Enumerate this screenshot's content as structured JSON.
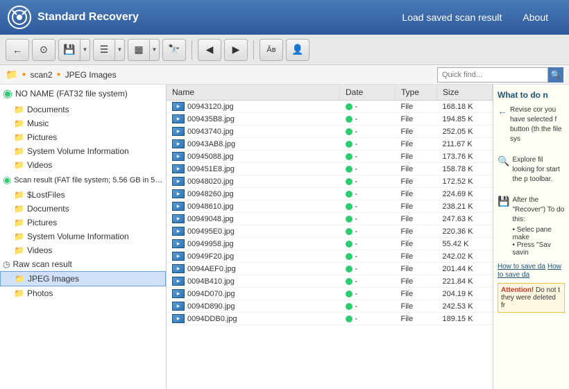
{
  "header": {
    "title": "Standard Recovery",
    "nav": {
      "load_scan": "Load saved scan result",
      "about": "About"
    }
  },
  "breadcrumb": {
    "icon": "📁",
    "path1": "scan2",
    "separator": "●",
    "path2": "JPEG Images",
    "quick_find_placeholder": "Quick find..."
  },
  "toolbar": {
    "back_label": "←",
    "search_label": "🔍",
    "save_label": "💾",
    "list_label": "☰",
    "grid_label": "▦",
    "binoculars_label": "🔭",
    "prev_label": "◀",
    "next_label": "▶",
    "text_label": "Ăв",
    "profile_label": "👤"
  },
  "left_panel": {
    "items": [
      {
        "label": "NO NAME (FAT32 file system)",
        "indent": 0,
        "type": "drive"
      },
      {
        "label": "Documents",
        "indent": 1,
        "type": "folder"
      },
      {
        "label": "Music",
        "indent": 1,
        "type": "folder"
      },
      {
        "label": "Pictures",
        "indent": 1,
        "type": "folder"
      },
      {
        "label": "System Volume Information",
        "indent": 1,
        "type": "folder"
      },
      {
        "label": "Videos",
        "indent": 1,
        "type": "folder"
      },
      {
        "label": "Scan result (FAT file system; 5.56 GB in 5…",
        "indent": 0,
        "type": "scan"
      },
      {
        "label": "$LostFiles",
        "indent": 1,
        "type": "folder"
      },
      {
        "label": "Documents",
        "indent": 1,
        "type": "folder"
      },
      {
        "label": "Pictures",
        "indent": 1,
        "type": "folder"
      },
      {
        "label": "System Volume Information",
        "indent": 1,
        "type": "folder"
      },
      {
        "label": "Videos",
        "indent": 1,
        "type": "folder"
      },
      {
        "label": "Raw scan result",
        "indent": 0,
        "type": "raw"
      },
      {
        "label": "JPEG Images",
        "indent": 1,
        "type": "folder",
        "selected": true
      },
      {
        "label": "Photos",
        "indent": 1,
        "type": "folder"
      }
    ]
  },
  "file_table": {
    "columns": [
      "Name",
      "Date",
      "Type",
      "Size"
    ],
    "rows": [
      {
        "name": "00943120.jpg",
        "date": "-",
        "type": "File",
        "size": "168.18 K"
      },
      {
        "name": "009435B8.jpg",
        "date": "-",
        "type": "File",
        "size": "194.85 K"
      },
      {
        "name": "00943740.jpg",
        "date": "-",
        "type": "File",
        "size": "252.05 K"
      },
      {
        "name": "00943AB8.jpg",
        "date": "-",
        "type": "File",
        "size": "211.67 K"
      },
      {
        "name": "00945088.jpg",
        "date": "-",
        "type": "File",
        "size": "173.76 K"
      },
      {
        "name": "009451E8.jpg",
        "date": "-",
        "type": "File",
        "size": "158.78 K"
      },
      {
        "name": "00948020.jpg",
        "date": "-",
        "type": "File",
        "size": "172.52 K"
      },
      {
        "name": "00948260.jpg",
        "date": "-",
        "type": "File",
        "size": "224.69 K"
      },
      {
        "name": "00948610.jpg",
        "date": "-",
        "type": "File",
        "size": "238.21 K"
      },
      {
        "name": "00949048.jpg",
        "date": "-",
        "type": "File",
        "size": "247.63 K"
      },
      {
        "name": "009495E0.jpg",
        "date": "-",
        "type": "File",
        "size": "220.36 K"
      },
      {
        "name": "00949958.jpg",
        "date": "-",
        "type": "File",
        "size": "55.42 K"
      },
      {
        "name": "00949F20.jpg",
        "date": "-",
        "type": "File",
        "size": "242.02 K"
      },
      {
        "name": "0094AEF0.jpg",
        "date": "-",
        "type": "File",
        "size": "201.44 K"
      },
      {
        "name": "0094B410.jpg",
        "date": "-",
        "type": "File",
        "size": "221.84 K"
      },
      {
        "name": "0094D070.jpg",
        "date": "-",
        "type": "File",
        "size": "204.19 K"
      },
      {
        "name": "0094D890.jpg",
        "date": "-",
        "type": "File",
        "size": "242.53 K"
      },
      {
        "name": "0094DDB0.jpg",
        "date": "-",
        "type": "File",
        "size": "189.15 K"
      }
    ]
  },
  "right_panel": {
    "title": "What to do n",
    "text1": "Revise cor you have selected f button (th the file sys",
    "text2": "Explore fil looking for start the p toolbar.",
    "text3": "After the \"Recover\") To do this:",
    "bullet1": "Selec pane make",
    "bullet2": "Press \"Sav savin",
    "link": "How to save da",
    "attention_title": "Attention!",
    "attention_text": "Do not t they were deleted fr"
  }
}
